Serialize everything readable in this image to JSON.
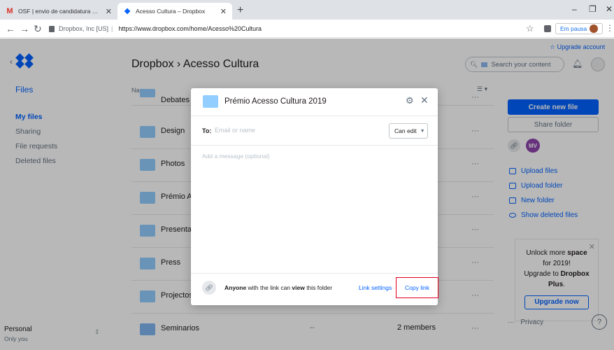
{
  "browser": {
    "tabs": [
      {
        "icon": "gmail-icon",
        "title": "OSF | envio de candidatura Prém"
      },
      {
        "icon": "dropbox-icon",
        "title": "Acesso Cultura – Dropbox"
      }
    ],
    "new_tab": "+",
    "window_controls": [
      "–",
      "❐",
      "✕"
    ],
    "address": {
      "site_identity": "Dropbox, Inc [US]",
      "url": "https://www.dropbox.com/home/Acesso%20Cultura"
    },
    "profile_status": "Em pausa"
  },
  "header": {
    "upgrade_link": "Upgrade account",
    "breadcrumb": "Dropbox › Acesso Cultura",
    "search_placeholder": "Search your content"
  },
  "sidebar": {
    "files": "Files",
    "items": [
      {
        "label": "My files",
        "active": true
      },
      {
        "label": "Sharing",
        "active": false
      },
      {
        "label": "File requests",
        "active": false
      },
      {
        "label": "Deleted files",
        "active": false
      }
    ],
    "account": {
      "name": "Personal",
      "sub": "Only you"
    }
  },
  "file_list": {
    "column_name": "Name ↓",
    "view_toggle": "☰ ▾",
    "rows": [
      {
        "name": "Debates",
        "modified": "",
        "members": ""
      },
      {
        "name": "Design",
        "modified": "",
        "members": ""
      },
      {
        "name": "Photos",
        "modified": "",
        "members": ""
      },
      {
        "name": "Prémio Ac",
        "modified": "",
        "members": ""
      },
      {
        "name": "Presentati",
        "modified": "",
        "members": ""
      },
      {
        "name": "Press",
        "modified": "",
        "members": ""
      },
      {
        "name": "Projectos",
        "modified": "",
        "members": ""
      },
      {
        "name": "Seminarios",
        "modified": "--",
        "members": "2 members"
      }
    ],
    "row_menu": "···"
  },
  "right_panel": {
    "create_new_file": "Create new file",
    "share_folder": "Share folder",
    "member_initials": "MV",
    "actions": [
      {
        "label": "Upload files",
        "icon": "upload-files-icon"
      },
      {
        "label": "Upload folder",
        "icon": "upload-folder-icon"
      },
      {
        "label": "New folder",
        "icon": "new-folder-icon"
      },
      {
        "label": "Show deleted files",
        "icon": "eye-icon"
      }
    ],
    "promo": {
      "line1": "Unlock more",
      "line1_bold": "space",
      "line2": "for 2019!",
      "line3": "Upgrade to",
      "line3_bold": "Dropbox",
      "line4_bold": "Plus",
      "line4": ".",
      "button": "Upgrade now"
    },
    "footer_dots": "···",
    "privacy": "Privacy",
    "help": "?"
  },
  "share_modal": {
    "title": "Prémio Acesso Cultura 2019",
    "to_label": "To:",
    "email_placeholder": "Email or name",
    "permission": "Can edit",
    "message_placeholder": "Add a message (optional)",
    "link_anyone": "Anyone",
    "link_middle": "with the link can",
    "link_view": "view",
    "link_tail": "this folder",
    "link_settings": "Link settings",
    "separator": "·",
    "copy_link": "Copy link",
    "highlight_color": "#e0001b"
  },
  "colors": {
    "brand": "#0061ff",
    "folder": "#92ceff",
    "avatar": "#8e44ad"
  }
}
